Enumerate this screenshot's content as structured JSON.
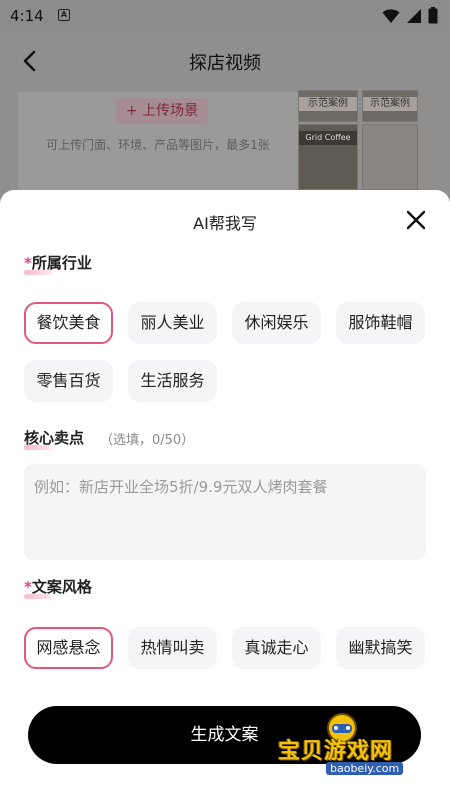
{
  "status": {
    "time": "4:14",
    "notif_badge": "A"
  },
  "page": {
    "title": "探店视频"
  },
  "upload": {
    "button_label": "+ 上传场景",
    "hint": "可上传门面、环境、产品等图片，最多1张"
  },
  "thumbnails": [
    {
      "label": "示范案例"
    },
    {
      "label": "示范案例"
    },
    {
      "label": "Grid Coffee"
    }
  ],
  "sheet": {
    "title": "AI帮我写",
    "industry": {
      "required_mark": "*",
      "label": "所属行业",
      "options": [
        "餐饮美食",
        "丽人美业",
        "休闲娱乐",
        "服饰鞋帽",
        "零售百货",
        "生活服务"
      ],
      "selected": "餐饮美食"
    },
    "selling_point": {
      "label": "核心卖点",
      "hint": "（选填，0/50）",
      "placeholder": "例如：新店开业全场5折/9.9元双人烤肉套餐"
    },
    "style": {
      "required_mark": "*",
      "label": "文案风格",
      "options": [
        "网感悬念",
        "热情叫卖",
        "真诚走心",
        "幽默搞笑"
      ],
      "selected": "网感悬念"
    },
    "generate_label": "生成文案"
  },
  "watermark": {
    "text": "宝贝游戏网",
    "url": "baobeiy.com"
  },
  "colors": {
    "accent": "#e2577f",
    "button": "#000000"
  }
}
